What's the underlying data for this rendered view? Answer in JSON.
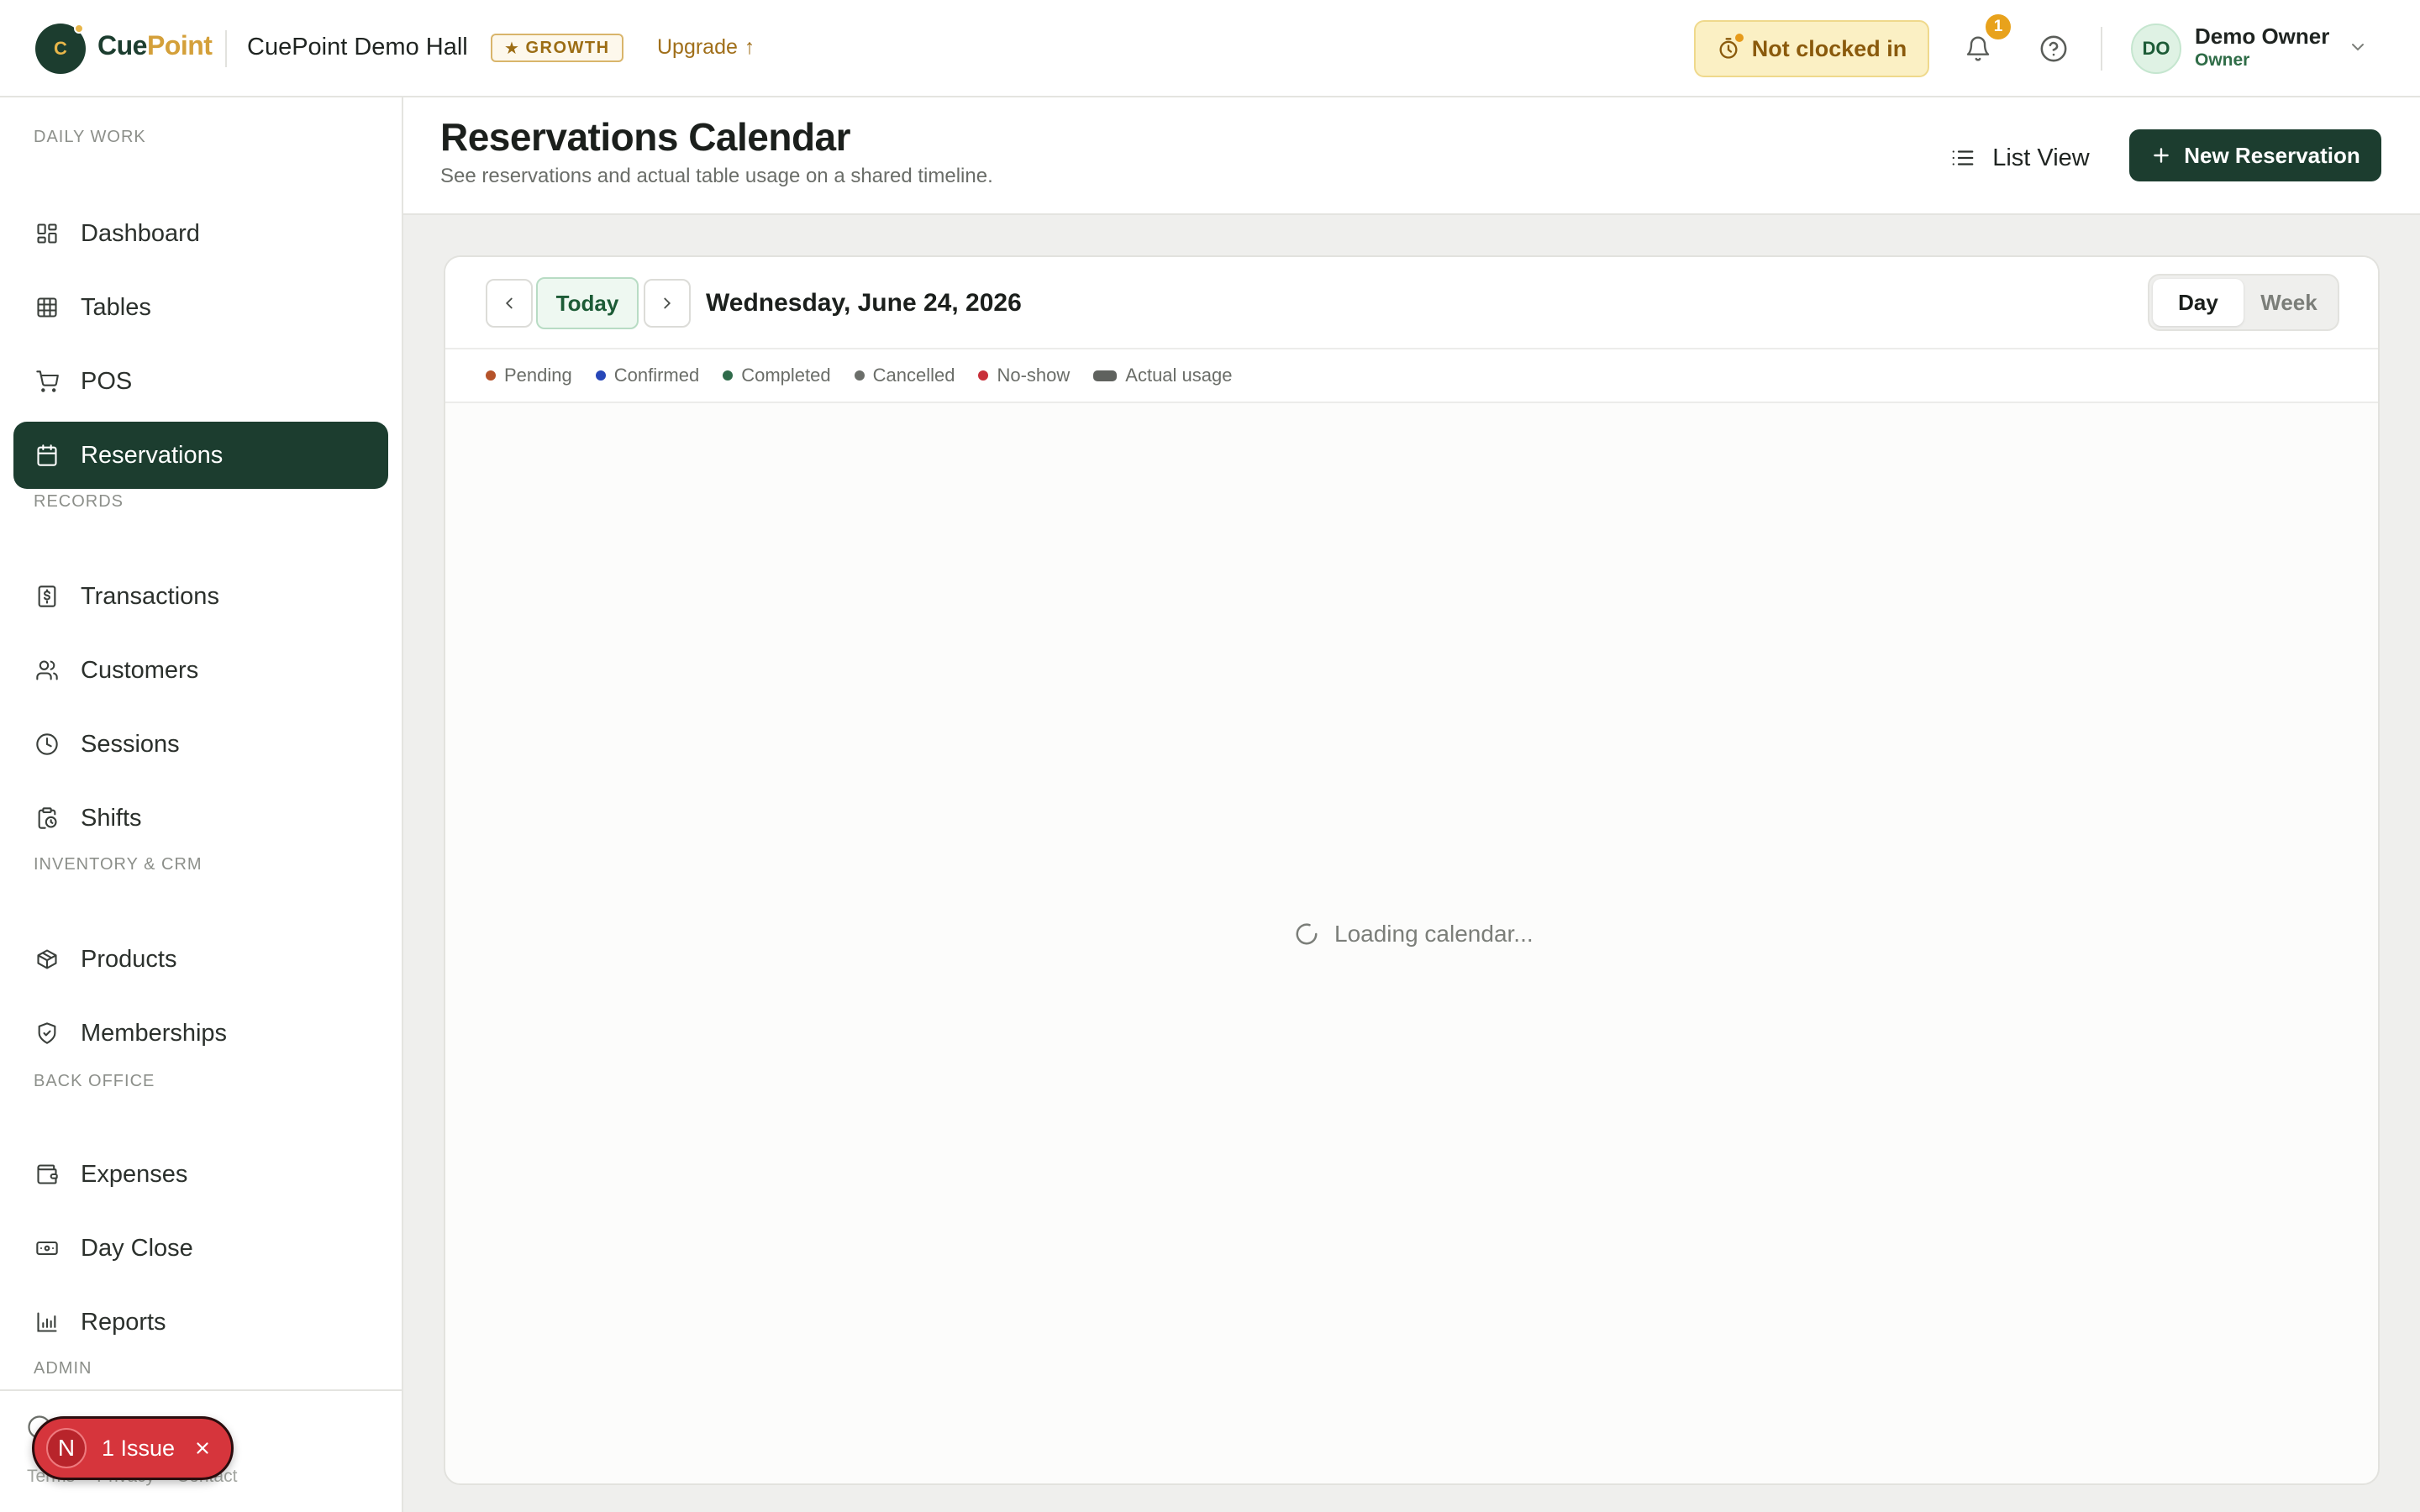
{
  "brand": {
    "name_part1": "Cue",
    "name_part2": "Point",
    "logo_letter": "C"
  },
  "venue": {
    "name": "CuePoint Demo Hall",
    "plan": "GROWTH"
  },
  "upgrade": {
    "label": "Upgrade",
    "arrow": "↑"
  },
  "clock": {
    "label": "Not clocked in"
  },
  "notifications": {
    "count": "1"
  },
  "user": {
    "initials": "DO",
    "name": "Demo Owner",
    "role": "Owner"
  },
  "sidebar": {
    "sections": [
      {
        "label": "DAILY WORK"
      },
      {
        "label": "RECORDS"
      },
      {
        "label": "INVENTORY & CRM"
      },
      {
        "label": "BACK OFFICE"
      },
      {
        "label": "ADMIN"
      }
    ],
    "items": [
      {
        "label": "Dashboard",
        "icon": "dashboard-icon"
      },
      {
        "label": "Tables",
        "icon": "grid-icon"
      },
      {
        "label": "POS",
        "icon": "cart-icon"
      },
      {
        "label": "Reservations",
        "icon": "calendar-icon",
        "active": true
      },
      {
        "label": "Transactions",
        "icon": "receipt-icon"
      },
      {
        "label": "Customers",
        "icon": "users-icon"
      },
      {
        "label": "Sessions",
        "icon": "clock-icon"
      },
      {
        "label": "Shifts",
        "icon": "clipboard-clock-icon"
      },
      {
        "label": "Products",
        "icon": "package-icon"
      },
      {
        "label": "Memberships",
        "icon": "shield-icon"
      },
      {
        "label": "Expenses",
        "icon": "wallet-icon"
      },
      {
        "label": "Day Close",
        "icon": "banknote-icon"
      },
      {
        "label": "Reports",
        "icon": "bar-chart-icon"
      }
    ],
    "footer_links": [
      "Terms",
      "Privacy",
      "Contact"
    ]
  },
  "issue_indicator": {
    "letter": "N",
    "label": "1 Issue"
  },
  "page": {
    "title": "Reservations Calendar",
    "subtitle": "See reservations and actual table usage on a shared timeline.",
    "list_view_label": "List View",
    "new_reservation_label": "New Reservation"
  },
  "calendar": {
    "today_label": "Today",
    "date": "Wednesday, June 24, 2026",
    "views": [
      "Day",
      "Week"
    ],
    "active_view": "Day",
    "legend": [
      {
        "label": "Pending",
        "color": "#b5532a"
      },
      {
        "label": "Confirmed",
        "color": "#2747b8"
      },
      {
        "label": "Completed",
        "color": "#2f6b4a"
      },
      {
        "label": "Cancelled",
        "color": "#6b6e6a"
      },
      {
        "label": "No-show",
        "color": "#c8303a"
      },
      {
        "label": "Actual usage",
        "color": "#5f625e"
      }
    ],
    "loading_text": "Loading calendar..."
  },
  "colors": {
    "primary": "#1c3d2f",
    "accent": "#d4a03a",
    "warning_bg": "#fbf0c4",
    "danger": "#d6353c"
  }
}
